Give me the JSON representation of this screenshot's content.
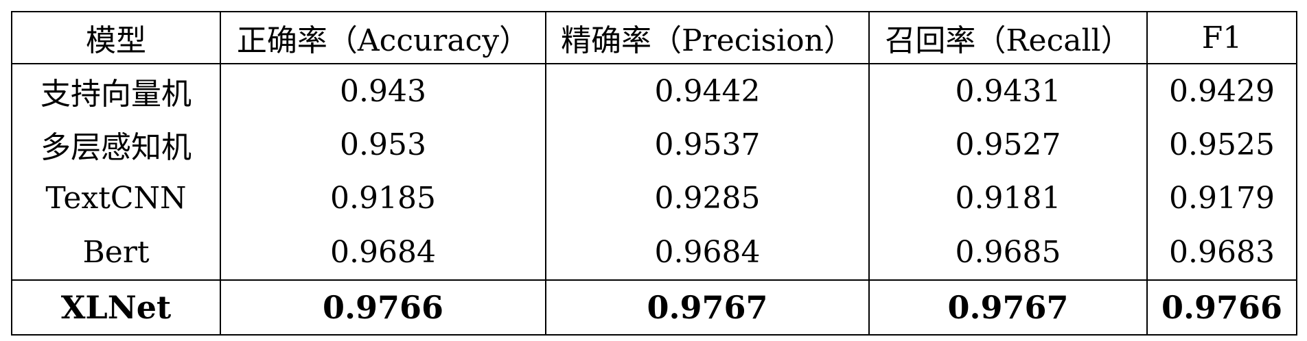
{
  "table": {
    "headers": [
      "模型",
      "正确率（Accuracy）",
      "精确率（Precision）",
      "召回率（Recall）",
      "F1"
    ],
    "rows": [
      [
        "支持向量机",
        "0.943",
        "0.9442",
        "0.9431",
        "0.9429"
      ],
      [
        "多层感知机",
        "0.953",
        "0.9537",
        "0.9527",
        "0.9525"
      ],
      [
        "TextCNN",
        "0.9185",
        "0.9285",
        "0.9181",
        "0.9179"
      ],
      [
        "Bert",
        "0.9684",
        "0.9684",
        "0.9685",
        "0.9683"
      ]
    ],
    "highlight_row": [
      "XLNet",
      "0.9766",
      "0.9767",
      "0.9767",
      "0.9766"
    ]
  }
}
